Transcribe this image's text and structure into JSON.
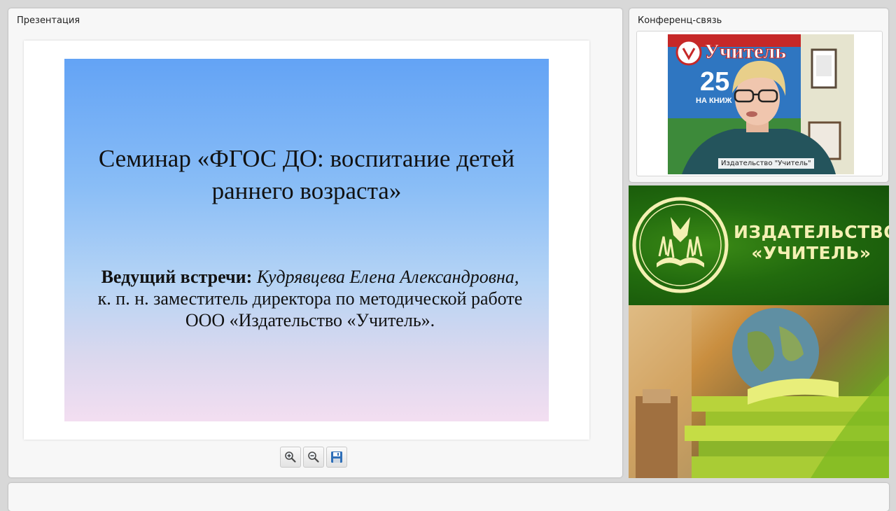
{
  "presentation": {
    "title": "Презентация",
    "slide": {
      "title": "Семинар «ФГОС ДО: воспитание детей раннего возраста»",
      "host_label": "Ведущий встречи:",
      "host_name": "Кудрявцева Елена Александровна,",
      "host_details": "к. п. н. заместитель директора по методической работе ООО «Издательство «Учитель»."
    },
    "toolbar": {
      "zoom_in_icon": "zoom-in-icon",
      "zoom_out_icon": "zoom-out-icon",
      "save_icon": "save-icon"
    }
  },
  "conference": {
    "title": "Конференц-связь",
    "video_label": "Издательство \"Учитель\"",
    "video_background": {
      "logo_text": "Учитель",
      "anniversary_number": "25",
      "anniversary_subtext": "НА КНИЖ"
    }
  },
  "banner": {
    "line1": "ИЗДАТЕЛЬСТВО",
    "line2": "«УЧИТЕЛЬ»",
    "colors": {
      "green": "#226b0e",
      "text": "#f4f0b3"
    }
  }
}
